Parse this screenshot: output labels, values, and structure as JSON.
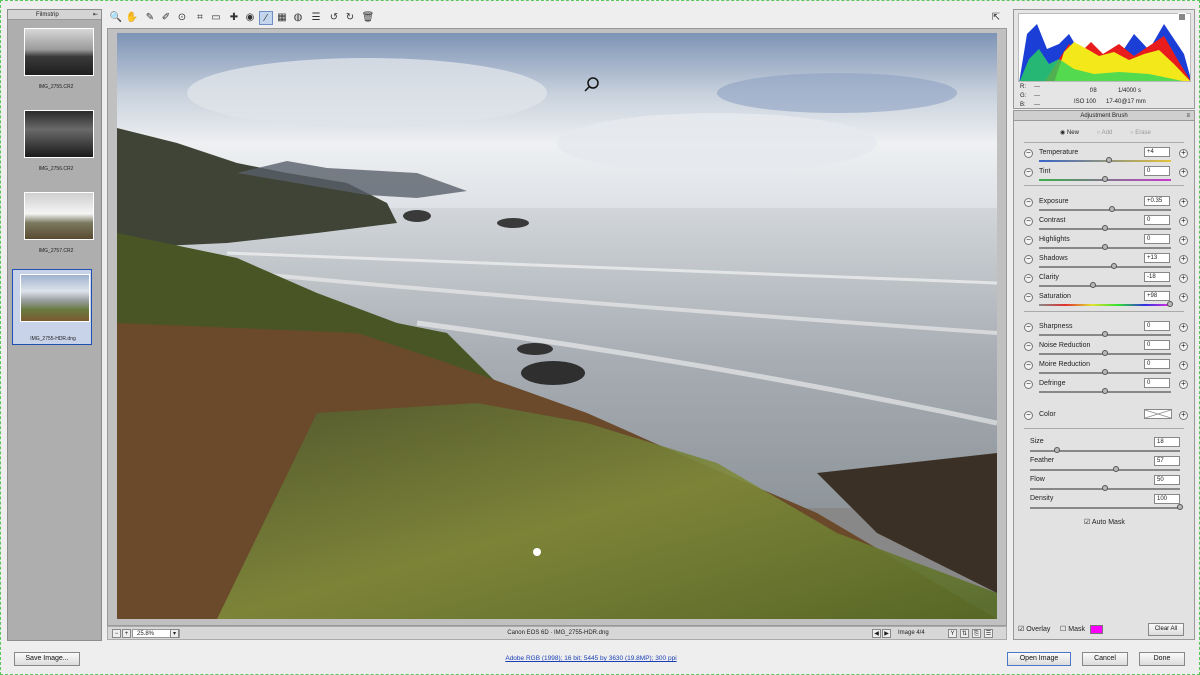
{
  "filmstrip": {
    "title": "Filmstrip",
    "items": [
      {
        "name": "IMG_2755.CR2"
      },
      {
        "name": "IMG_2756.CR2"
      },
      {
        "name": "IMG_2757.CR2"
      },
      {
        "name": "IMG_2755-HDR.dng",
        "selected": true
      }
    ]
  },
  "toolbar": {
    "tools": [
      "zoom-icon",
      "hand-icon",
      "eyedropper-icon",
      "color-sampler-icon",
      "targeted-adjustment-icon",
      "crop-icon",
      "straighten-icon",
      "spot-removal-icon",
      "red-eye-icon",
      "adjustment-brush-icon",
      "graduated-filter-icon",
      "radial-filter-icon",
      "preferences-icon",
      "rotate-left-icon",
      "rotate-right-icon",
      "trash-icon"
    ],
    "active_tool": "adjustment-brush-icon"
  },
  "status": {
    "zoom": "25.8%",
    "camera_file": "Canon EOS 6D  ·  IMG_2755-HDR.dng",
    "image_count": "Image 4/4"
  },
  "histogram": {
    "r_label": "R:",
    "r_value": "---",
    "g_label": "G:",
    "g_value": "---",
    "b_label": "B:",
    "b_value": "---",
    "aperture": "f/8",
    "shutter": "1/4000 s",
    "iso": "ISO 100",
    "lens": "17-40@17 mm"
  },
  "adjustment_brush": {
    "title": "Adjustment Brush",
    "modes": [
      "New",
      "Add",
      "Erase"
    ],
    "selected_mode": "New",
    "sliders": [
      {
        "label": "Temperature",
        "value": "+4",
        "pos": 0.53
      },
      {
        "label": "Tint",
        "value": "0",
        "pos": 0.5
      },
      {
        "label": "Exposure",
        "value": "+0.35",
        "pos": 0.55
      },
      {
        "label": "Contrast",
        "value": "0",
        "pos": 0.5
      },
      {
        "label": "Highlights",
        "value": "0",
        "pos": 0.5
      },
      {
        "label": "Shadows",
        "value": "+13",
        "pos": 0.57
      },
      {
        "label": "Clarity",
        "value": "-18",
        "pos": 0.41
      },
      {
        "label": "Saturation",
        "value": "+98",
        "pos": 0.99
      },
      {
        "label": "Sharpness",
        "value": "0",
        "pos": 0.5
      },
      {
        "label": "Noise Reduction",
        "value": "0",
        "pos": 0.5
      },
      {
        "label": "Moire Reduction",
        "value": "0",
        "pos": 0.5
      },
      {
        "label": "Defringe",
        "value": "0",
        "pos": 0.5
      }
    ],
    "color_label": "Color",
    "brush": [
      {
        "label": "Size",
        "value": "18",
        "pos": 0.18
      },
      {
        "label": "Feather",
        "value": "57",
        "pos": 0.57
      },
      {
        "label": "Flow",
        "value": "50",
        "pos": 0.5
      },
      {
        "label": "Density",
        "value": "100",
        "pos": 1.0
      }
    ],
    "auto_mask_label": "Auto Mask",
    "overlay_label": "Overlay",
    "mask_label": "Mask",
    "mask_color": "#ff00ff",
    "clear_all_label": "Clear All"
  },
  "footer": {
    "save_image": "Save Image...",
    "workflow_link": "Adobe RGB (1998); 16 bit; 5445 by 3630 (19.8MP); 300 ppi",
    "open_image": "Open Image",
    "cancel": "Cancel",
    "done": "Done"
  }
}
